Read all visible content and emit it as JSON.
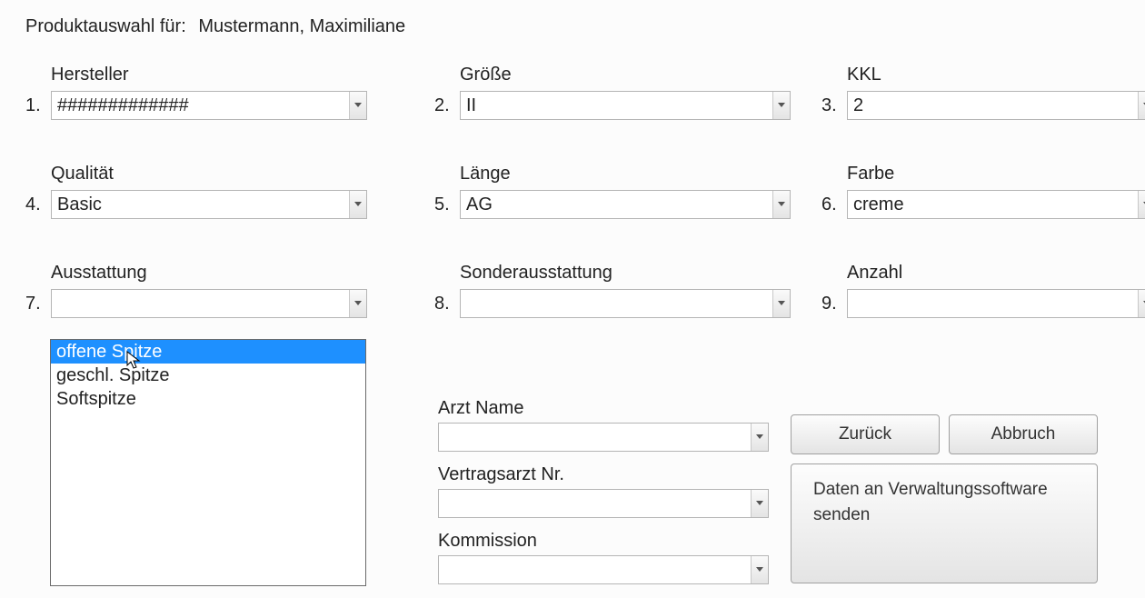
{
  "header": {
    "label": "Produktauswahl für:",
    "customer": "Mustermann, Maximiliane"
  },
  "fields": {
    "hersteller": {
      "num": "1.",
      "label": "Hersteller",
      "value": "#############"
    },
    "groesse": {
      "num": "2.",
      "label": "Größe",
      "value": "II"
    },
    "kkl": {
      "num": "3.",
      "label": "KKL",
      "value": "2"
    },
    "qualitaet": {
      "num": "4.",
      "label": "Qualität",
      "value": "Basic"
    },
    "laenge": {
      "num": "5.",
      "label": "Länge",
      "value": "AG"
    },
    "farbe": {
      "num": "6.",
      "label": "Farbe",
      "value": "creme"
    },
    "ausstattung": {
      "num": "7.",
      "label": "Ausstattung",
      "value": ""
    },
    "sonderausstattung": {
      "num": "8.",
      "label": "Sonderausstattung",
      "value": ""
    },
    "anzahl": {
      "num": "9.",
      "label": "Anzahl",
      "value": ""
    },
    "arzt_name": {
      "label": "Arzt Name",
      "value": ""
    },
    "vertragsarzt_nr": {
      "label": "Vertragsarzt Nr.",
      "value": ""
    },
    "kommission": {
      "label": "Kommission",
      "value": ""
    }
  },
  "ausstattung_options": {
    "opt0": "offene Spitze",
    "opt1": "geschl. Spitze",
    "opt2": "Softspitze"
  },
  "buttons": {
    "back": "Zurück",
    "cancel": "Abbruch",
    "send": "Daten an Verwaltungssoftware senden"
  }
}
